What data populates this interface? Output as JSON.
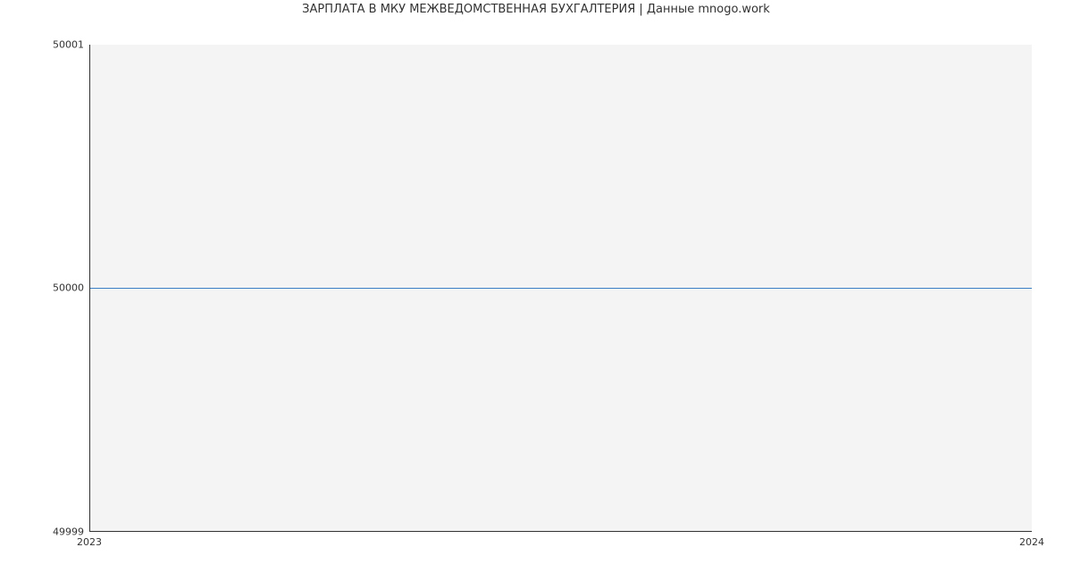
{
  "chart_data": {
    "type": "line",
    "title": "ЗАРПЛАТА В МКУ МЕЖВЕДОМСТВЕННАЯ БУХГАЛТЕРИЯ | Данные mnogo.work",
    "xlabel": "",
    "ylabel": "",
    "x": [
      "2023",
      "2024"
    ],
    "series": [
      {
        "name": "salary",
        "values": [
          50000,
          50000
        ],
        "color": "#3b7fc4"
      }
    ],
    "ylim": [
      49999,
      50001
    ],
    "y_ticks": [
      "49999",
      "50000",
      "50001"
    ],
    "x_ticks": [
      "2023",
      "2024"
    ],
    "grid": true
  }
}
